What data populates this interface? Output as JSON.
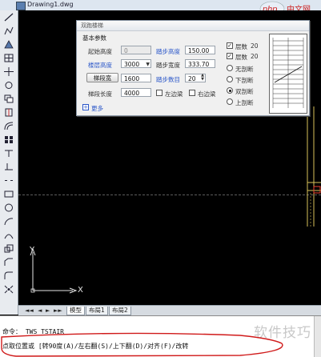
{
  "window": {
    "title": "Drawing1.dwg"
  },
  "toolbar": {
    "icons": [
      "line-icon",
      "polyline-icon",
      "triangle-icon",
      "grid-icon",
      "move-icon",
      "rotate-icon",
      "copy-icon",
      "mirror-icon",
      "offset-icon",
      "array-icon",
      "trim-icon",
      "extend-icon",
      "break-icon",
      "rectangle-icon",
      "circle-icon",
      "arc-icon",
      "stretch-icon",
      "scale-icon",
      "chamfer-icon",
      "fillet-icon",
      "explode-icon"
    ]
  },
  "dialog": {
    "title": "双跑楼梯",
    "group_title": "基本参数",
    "labels": {
      "start_height": "起始高度",
      "floor_height": "楼层高度",
      "stair_width": "梯段宽",
      "stair_length": "梯段长度",
      "step_height": "踏步高度",
      "step_width": "踏步宽度",
      "step_count": "踏步数目",
      "left_edge": "左边梁",
      "right_edge": "右边梁",
      "more": "更多"
    },
    "values": {
      "start_height": "0",
      "floor_height": "3000",
      "stair_width": "1600",
      "stair_length": "4000",
      "step_height": "150.00",
      "step_width": "333.70",
      "step_count": "20"
    },
    "checks": {
      "opt1": "层数",
      "opt2": "层数"
    },
    "check_values": {
      "opt1": "20",
      "opt2": "20"
    },
    "radios": [
      "无剖断",
      "下剖断",
      "双剖断",
      "上剖断"
    ],
    "selected_radio": 2
  },
  "tabs": {
    "nav": [
      "◄◄",
      "◄",
      "►",
      "►►"
    ],
    "items": [
      "模型",
      "布局1",
      "布局2"
    ]
  },
  "command": {
    "line1": "命令：  TWS_TSTAIR",
    "line2": "点取位置或 [转90度(A)/左右翻(S)/上下翻(D)/对齐(F)/改转"
  },
  "watermark": "软件技巧",
  "logo": {
    "brand": "php",
    "sub": "中文网"
  },
  "ucs": {
    "x": "X",
    "y": "Y"
  },
  "colors": {
    "canvas": "#000000",
    "dialog": "#f0f0f0",
    "label_blue": "#2b57c9",
    "scribble": "#d01a1a"
  }
}
